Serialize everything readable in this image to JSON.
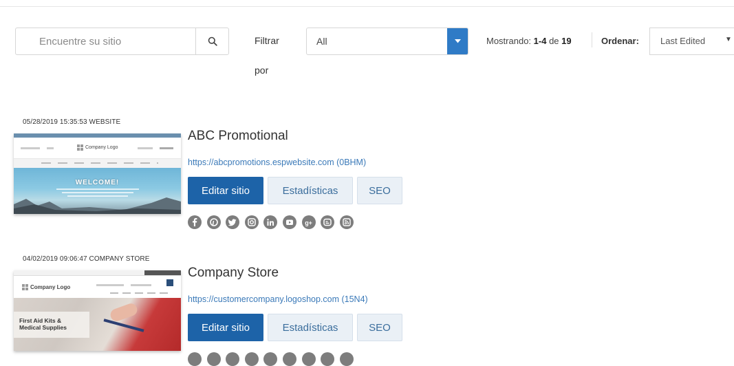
{
  "search": {
    "placeholder": "Encuentre su sitio",
    "icon": "search-icon"
  },
  "filter": {
    "label_line1": "Filtrar",
    "label_line2": "por",
    "value": "All"
  },
  "results": {
    "prefix": "Mostrando: ",
    "range": "1-4",
    "middle": " de ",
    "total": "19"
  },
  "sort": {
    "label": "Ordenar:",
    "value": "Last Edited"
  },
  "sites": [
    {
      "meta": "05/28/2019 15:35:53 WEBSITE",
      "title": "ABC Promotional",
      "url": "https://abcpromotions.espwebsite.com (0BHM)",
      "thumbnail": {
        "logo_text": "Company Logo",
        "hero_text": "WELCOME!"
      },
      "buttons": {
        "edit": "Editar sitio",
        "stats": "Estadísticas",
        "seo": "SEO"
      }
    },
    {
      "meta": "04/02/2019 09:06:47 COMPANY STORE",
      "title": "Company Store",
      "url": "https://customercompany.logoshop.com (15N4)",
      "thumbnail": {
        "logo_text": "Company Logo",
        "hero_text_line1": "First Aid Kits &",
        "hero_text_line2": "Medical Supplies"
      },
      "buttons": {
        "edit": "Editar sitio",
        "stats": "Estadísticas",
        "seo": "SEO"
      }
    }
  ],
  "social_icons": [
    "facebook-icon",
    "pinterest-icon",
    "twitter-icon",
    "instagram-icon",
    "linkedin-icon",
    "youtube-icon",
    "google-plus-icon",
    "blogger-icon",
    "rss-icon"
  ],
  "colors": {
    "primary": "#1d63a8",
    "accent": "#2f7bc6",
    "link": "#3a79b8",
    "icon_grey": "#7d7d7d"
  }
}
